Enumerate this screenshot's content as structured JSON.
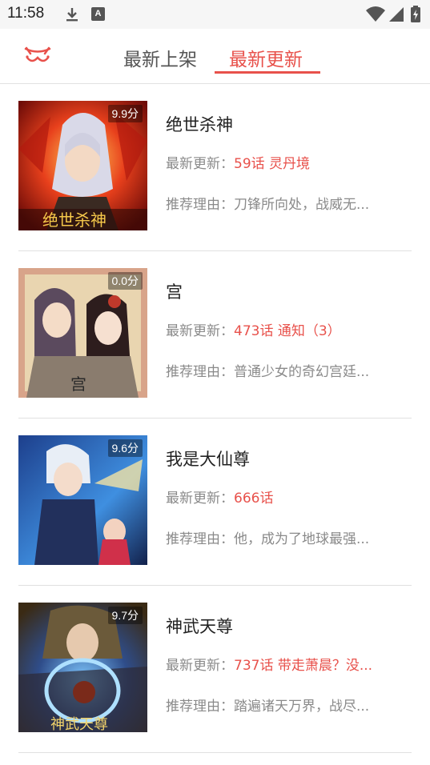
{
  "status_bar": {
    "time": "11:58",
    "icons": [
      "download-icon",
      "a-badge-icon",
      "wifi-icon",
      "signal-icon",
      "battery-charging-icon"
    ],
    "a_badge": "A"
  },
  "header": {
    "logo_icon": "cat-face-logo-icon",
    "tabs": [
      {
        "label": "最新上架",
        "active": false
      },
      {
        "label": "最新更新",
        "active": true
      }
    ],
    "accent_color": "#e8514b"
  },
  "list": {
    "update_prefix": "最新更新：",
    "reason_prefix": "推荐理由：",
    "items": [
      {
        "title": "绝世杀神",
        "score": "9.9分",
        "update": "59话 灵丹境",
        "reason": "刀锋所向处，战威无..."
      },
      {
        "title": "宫",
        "score": "0.0分",
        "update": "473话 通知（3）",
        "reason": "普通少女的奇幻宫廷..."
      },
      {
        "title": "我是大仙尊",
        "score": "9.6分",
        "update": "666话",
        "reason": "他，成为了地球最强..."
      },
      {
        "title": "神武天尊",
        "score": "9.7分",
        "update": "737话 带走萧晨？没...",
        "reason": "踏遍诸天万界，战尽..."
      }
    ]
  }
}
